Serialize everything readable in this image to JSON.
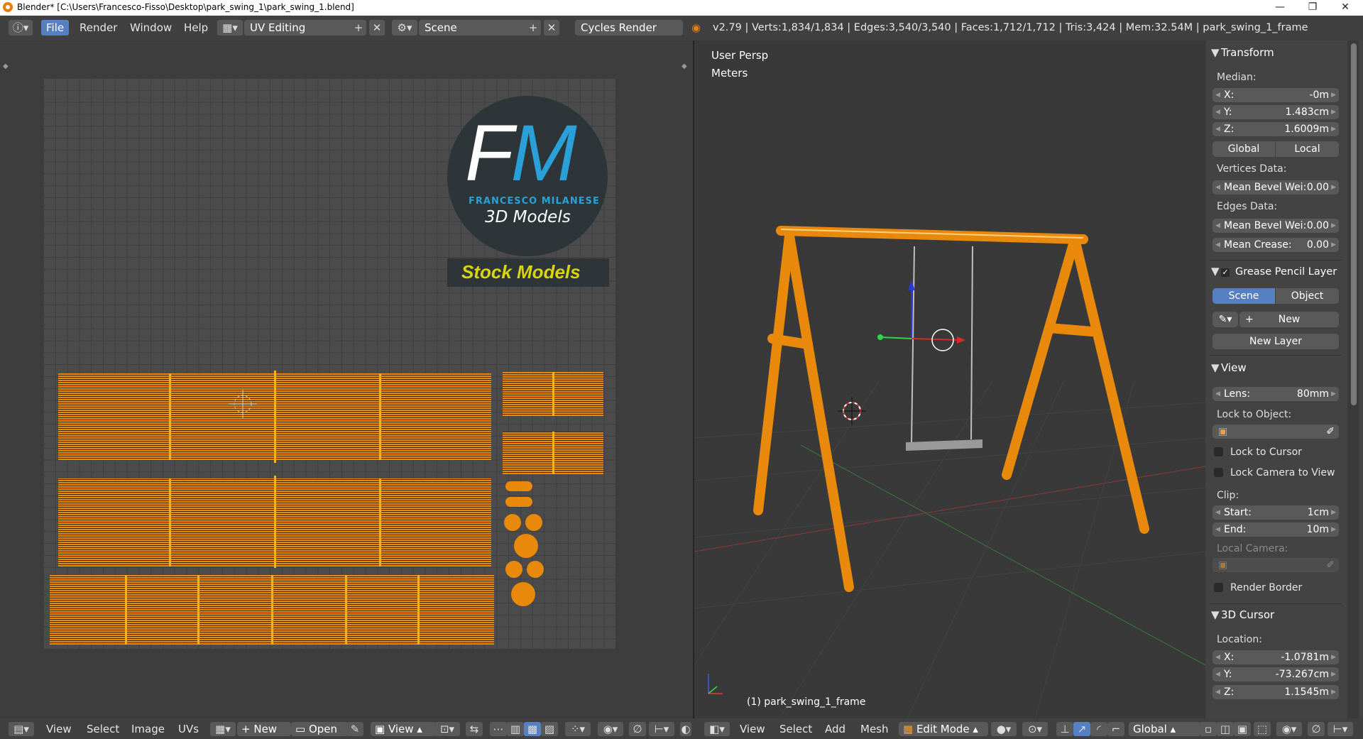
{
  "titlebar": {
    "title": "Blender* [C:\\Users\\Francesco-Fisso\\Desktop\\park_swing_1\\park_swing_1.blend]",
    "minimize": "—",
    "maximize": "❐",
    "close": "✕"
  },
  "infobar": {
    "menus": [
      "File",
      "Render",
      "Window",
      "Help"
    ],
    "layout": "UV Editing",
    "scene": "Scene",
    "engine": "Cycles Render",
    "stats": "v2.79 | Verts:1,834/1,834 | Edges:3,540/3,540 | Faces:1,712/1,712 | Tris:3,424 | Mem:32.54M | park_swing_1_frame"
  },
  "uv_image": {
    "logo_letters_f": "F",
    "logo_letters_m": "M",
    "logo_name": "FRANCESCO MILANESE",
    "logo_tagline": "3D Models",
    "stock_label": "Stock Models"
  },
  "viewport": {
    "view_name": "User Persp",
    "units": "Meters",
    "object_label": "(1) park_swing_1_frame"
  },
  "npanel": {
    "transform": {
      "title": "Transform",
      "median_label": "Median:",
      "x": {
        "label": "X:",
        "value": "-0m"
      },
      "y": {
        "label": "Y:",
        "value": "1.483cm"
      },
      "z": {
        "label": "Z:",
        "value": "1.6009m"
      },
      "global": "Global",
      "local": "Local",
      "vertices_data": "Vertices Data:",
      "v_bevel": {
        "label": "Mean Bevel Wei:",
        "value": "0.00"
      },
      "edges_data": "Edges Data:",
      "e_bevel": {
        "label": "Mean Bevel Wei:",
        "value": "0.00"
      },
      "crease": {
        "label": "Mean Crease:",
        "value": "0.00"
      }
    },
    "grease": {
      "title": "Grease Pencil Layer",
      "scene": "Scene",
      "object": "Object",
      "new": "New",
      "new_layer": "New Layer"
    },
    "view": {
      "title": "View",
      "lens": {
        "label": "Lens:",
        "value": "80mm"
      },
      "lock_object": "Lock to Object:",
      "lock_cursor": "Lock to Cursor",
      "lock_camera": "Lock Camera to View",
      "clip": "Clip:",
      "start": {
        "label": "Start:",
        "value": "1cm"
      },
      "end": {
        "label": "End:",
        "value": "10m"
      },
      "local_camera": "Local Camera:",
      "render_border": "Render Border"
    },
    "cursor": {
      "title": "3D Cursor",
      "location": "Location:",
      "x": {
        "label": "X:",
        "value": "-1.0781m"
      },
      "y": {
        "label": "Y:",
        "value": "-73.267cm"
      },
      "z": {
        "label": "Z:",
        "value": "1.1545m"
      }
    }
  },
  "uv_footer": {
    "menus": [
      "View",
      "Select",
      "Image",
      "UVs"
    ],
    "new": "New",
    "open": "Open",
    "view": "View"
  },
  "vp_footer": {
    "menus": [
      "View",
      "Select",
      "Add",
      "Mesh"
    ],
    "mode": "Edit Mode",
    "orientation": "Global"
  },
  "colors": {
    "accent": "#5680c2",
    "wire": "#e8890c",
    "header": "#404040"
  }
}
